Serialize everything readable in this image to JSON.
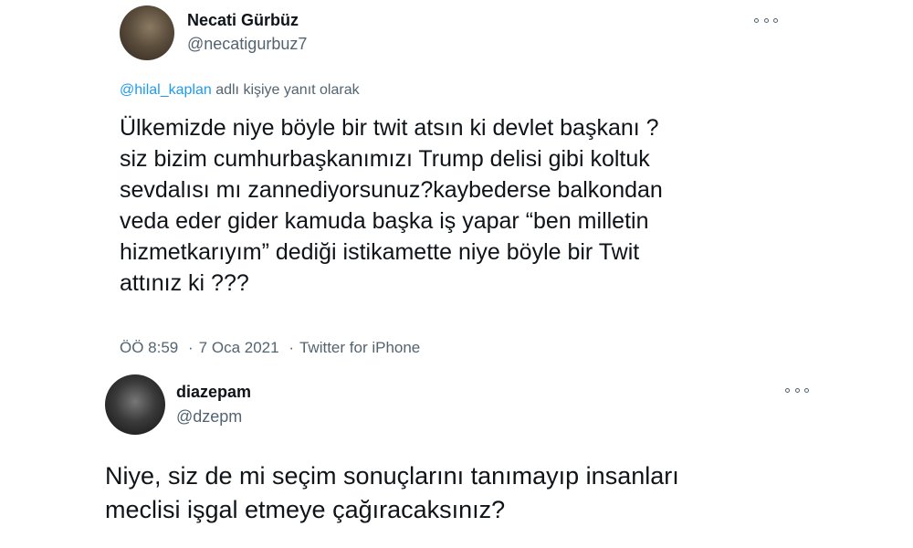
{
  "tweets": [
    {
      "display_name": "Necati Gürbüz",
      "handle": "@necatigurbuz7",
      "reply_to_mention": "@hilal_kaplan",
      "reply_to_suffix": " adlı kişiye yanıt olarak",
      "text": "Ülkemizde niye böyle bir twit atsın ki devlet başkanı ?\nsiz bizim cumhurbaşkanımızı Trump delisi gibi koltuk\nsevdalısı mı zannediyorsunuz?kaybederse balkondan\nveda eder gider kamuda başka iş yapar “ben milletin\nhizmetkarıyım” dediği istikamette niye böyle bir Twit\nattınız ki ???",
      "time": "ÖÖ 8:59",
      "separator": "·",
      "date": "7 Oca 2021",
      "source": "Twitter for iPhone",
      "more_icon": "more-horizontal-icon"
    },
    {
      "display_name": "diazepam",
      "handle": "@dzepm",
      "text": "Niye, siz de mi seçim sonuçlarını tanımayıp insanları\nmeclisi işgal etmeye çağıracaksınız?",
      "more_icon": "more-horizontal-icon"
    }
  ],
  "colors": {
    "text_primary": "#0f1419",
    "text_secondary": "#536471",
    "link": "#1d9bf0",
    "background": "#ffffff"
  }
}
